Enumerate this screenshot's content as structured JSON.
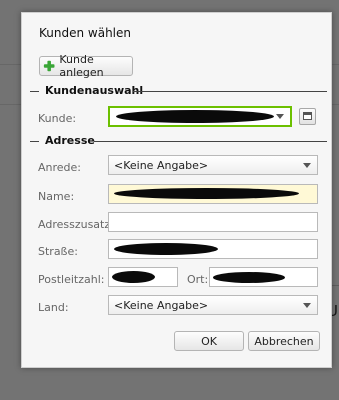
{
  "dialog": {
    "title": "Kunden wählen",
    "new_customer_button": "Kunde anlegen",
    "ok_button": "OK",
    "cancel_button": "Abbrechen"
  },
  "section_customer": {
    "title": "Kundenauswahl",
    "customer_label": "Kunde:"
  },
  "section_address": {
    "title": "Adresse",
    "salutation_label": "Anrede:",
    "salutation_value": "<Keine Angabe>",
    "name_label": "Name:",
    "address_extra_label": "Adresszusatz:",
    "street_label": "Straße:",
    "zip_label": "Postleitzahl:",
    "city_label": "Ort:",
    "country_label": "Land:",
    "country_value": "<Keine Angabe>"
  },
  "background": {
    "visible_fragment": "U"
  },
  "colors": {
    "focus_border": "#6cc000",
    "required_field_bg": "#fff9d6",
    "plus_icon": "#3aa637"
  }
}
